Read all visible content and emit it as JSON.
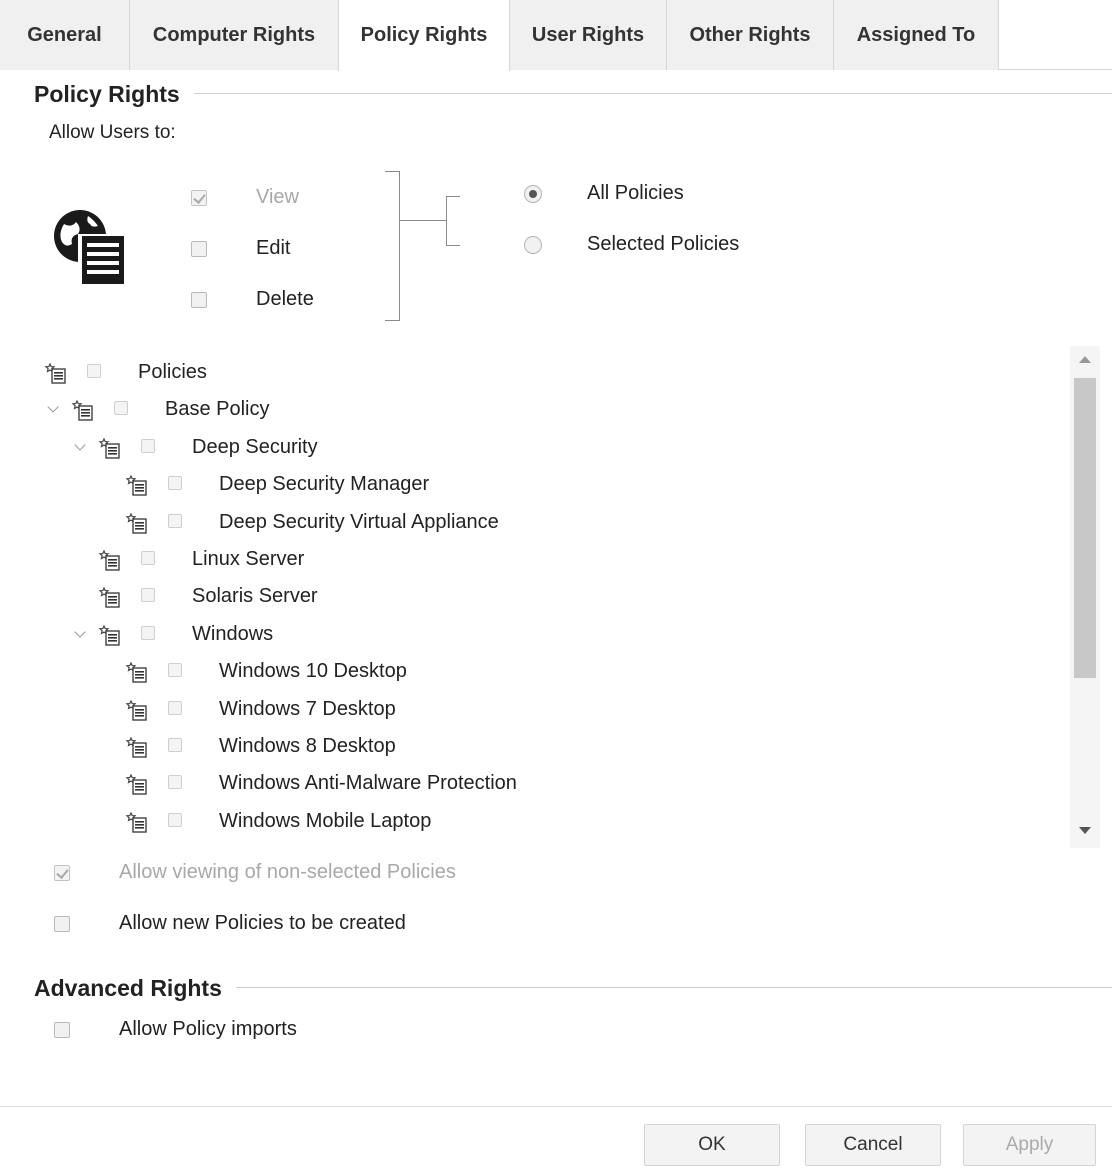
{
  "tabs": [
    {
      "label": "General",
      "active": false
    },
    {
      "label": "Computer Rights",
      "active": false
    },
    {
      "label": "Policy Rights",
      "active": true
    },
    {
      "label": "User Rights",
      "active": false
    },
    {
      "label": "Other Rights",
      "active": false
    },
    {
      "label": "Assigned To",
      "active": false
    }
  ],
  "policy_rights": {
    "title": "Policy Rights",
    "allow_label": "Allow Users to:",
    "icon": "globe-document-icon",
    "permissions": [
      {
        "label": "View",
        "checked": true,
        "disabled": true
      },
      {
        "label": "Edit",
        "checked": false,
        "disabled": false
      },
      {
        "label": "Delete",
        "checked": false,
        "disabled": false
      }
    ],
    "scope_options": [
      {
        "label": "All Policies",
        "selected": true
      },
      {
        "label": "Selected Policies",
        "selected": false
      }
    ],
    "tree": [
      {
        "label": "Policies",
        "depth": 0,
        "expandable": false
      },
      {
        "label": "Base Policy",
        "depth": 1,
        "expandable": true
      },
      {
        "label": "Deep Security",
        "depth": 2,
        "expandable": true
      },
      {
        "label": "Deep Security Manager",
        "depth": 3,
        "expandable": false
      },
      {
        "label": "Deep Security Virtual Appliance",
        "depth": 3,
        "expandable": false
      },
      {
        "label": "Linux Server",
        "depth": 2,
        "expandable": false
      },
      {
        "label": "Solaris Server",
        "depth": 2,
        "expandable": false
      },
      {
        "label": "Windows",
        "depth": 2,
        "expandable": true
      },
      {
        "label": "Windows 10 Desktop",
        "depth": 3,
        "expandable": false
      },
      {
        "label": "Windows 7 Desktop",
        "depth": 3,
        "expandable": false
      },
      {
        "label": "Windows 8 Desktop",
        "depth": 3,
        "expandable": false
      },
      {
        "label": "Windows Anti-Malware Protection",
        "depth": 3,
        "expandable": false
      },
      {
        "label": "Windows Mobile Laptop",
        "depth": 3,
        "expandable": false
      }
    ],
    "allow_viewing_non_selected": {
      "label": "Allow viewing of non-selected Policies",
      "checked": true,
      "disabled": true
    },
    "allow_new_policies": {
      "label": "Allow new Policies to be created",
      "checked": false
    }
  },
  "advanced_rights": {
    "title": "Advanced Rights",
    "allow_imports": {
      "label": "Allow Policy imports",
      "checked": false
    }
  },
  "buttons": {
    "ok": "OK",
    "cancel": "Cancel",
    "apply": "Apply"
  }
}
